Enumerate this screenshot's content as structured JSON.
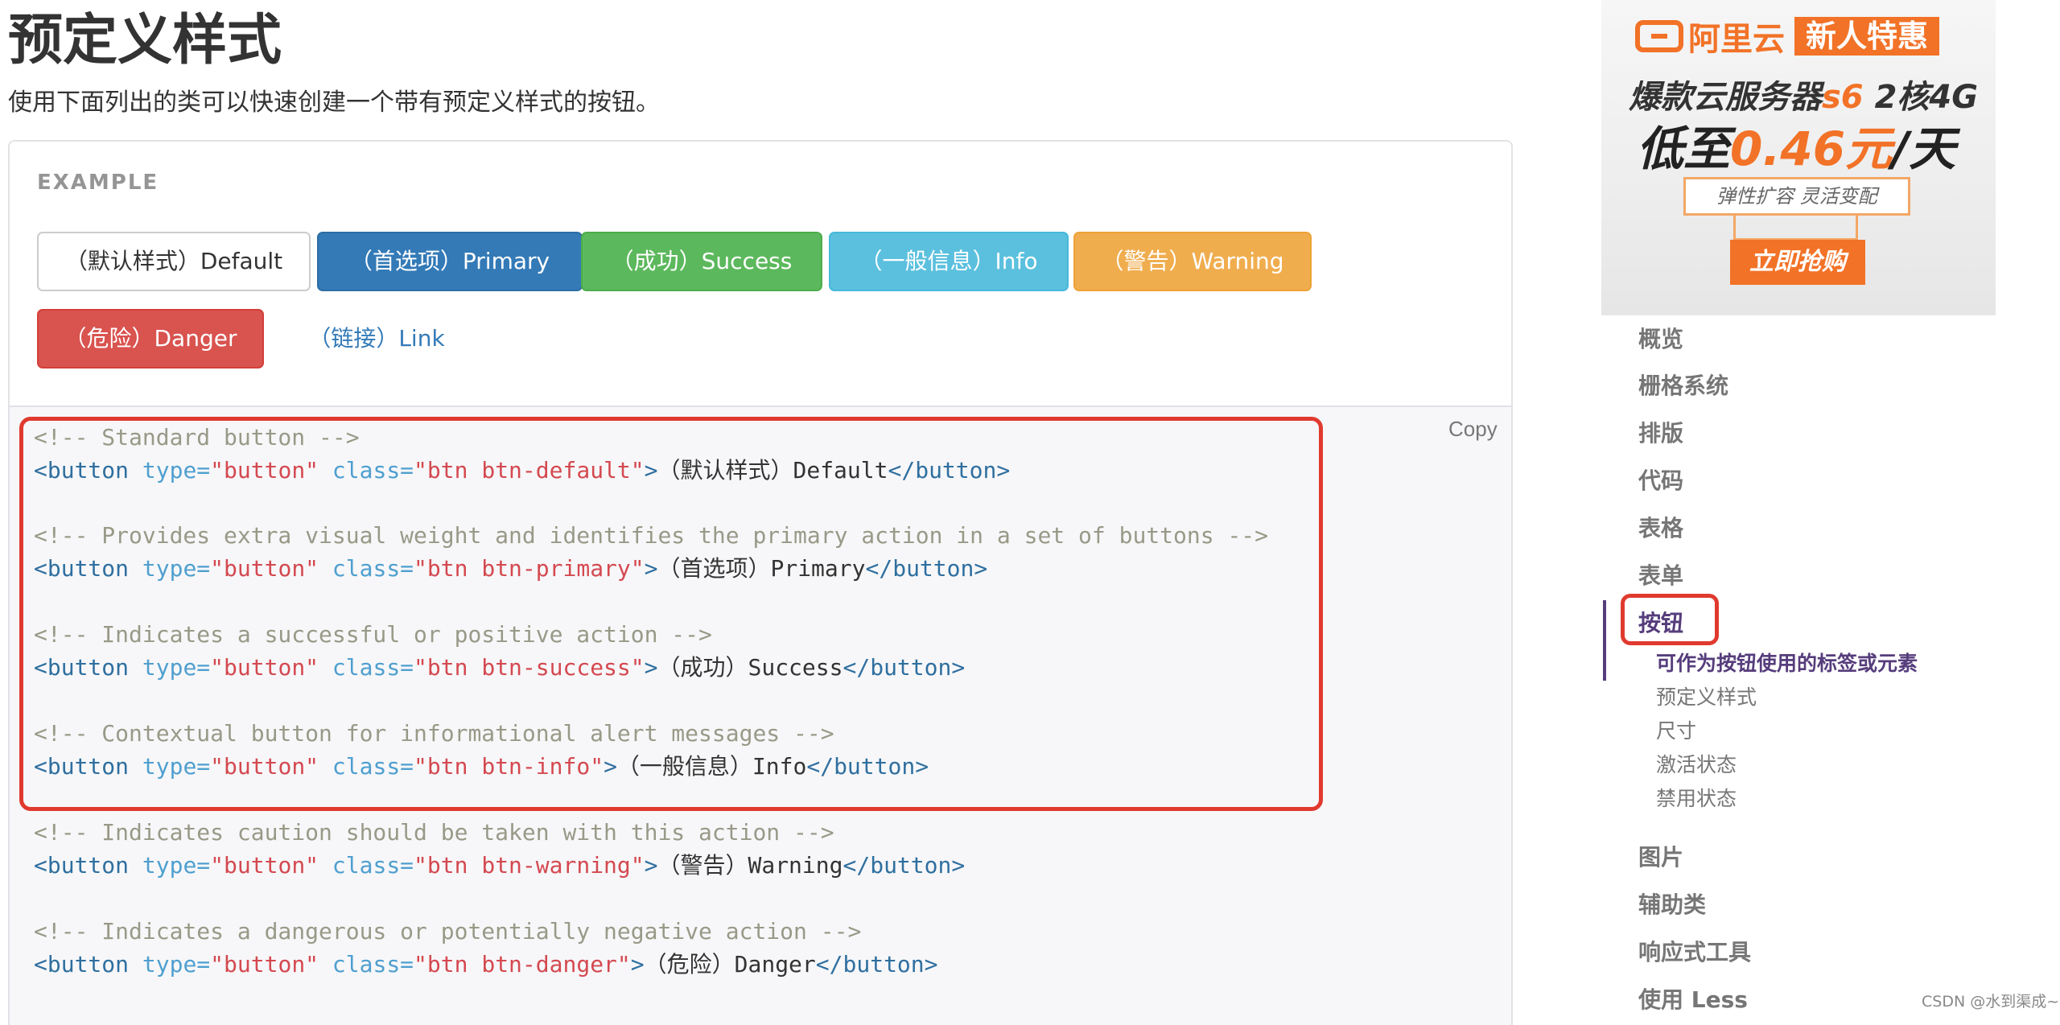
{
  "page": {
    "title": "预定义样式",
    "intro": "使用下面列出的类可以快速创建一个带有预定义样式的按钮。"
  },
  "example": {
    "label": "EXAMPLE",
    "buttons": [
      {
        "label": "（默认样式）Default",
        "style": "default"
      },
      {
        "label": "（首选项）Primary",
        "style": "primary"
      },
      {
        "label": "（成功）Success",
        "style": "success"
      },
      {
        "label": "（一般信息）Info",
        "style": "info"
      },
      {
        "label": "（警告）Warning",
        "style": "warning"
      },
      {
        "label": "（危险）Danger",
        "style": "danger"
      },
      {
        "label": "（链接）Link",
        "style": "link"
      }
    ]
  },
  "code": {
    "copy_label": "Copy",
    "lines": [
      {
        "comment": "<!-- Standard button -->"
      },
      {
        "attr_class": "\"btn btn-default\"",
        "text": "（默认样式）Default"
      },
      {
        "comment": "<!-- Provides extra visual weight and identifies the primary action in a set of buttons -->"
      },
      {
        "attr_class": "\"btn btn-primary\"",
        "text": "（首选项）Primary"
      },
      {
        "comment": "<!-- Indicates a successful or positive action -->"
      },
      {
        "attr_class": "\"btn btn-success\"",
        "text": "（成功）Success"
      },
      {
        "comment": "<!-- Contextual button for informational alert messages -->"
      },
      {
        "attr_class": "\"btn btn-info\"",
        "text": "（一般信息）Info"
      },
      {
        "comment": "<!-- Indicates caution should be taken with this action -->"
      },
      {
        "attr_class": "\"btn btn-warning\"",
        "text": "（警告）Warning"
      },
      {
        "comment": "<!-- Indicates a dangerous or potentially negative action -->"
      },
      {
        "attr_class": "\"btn btn-danger\"",
        "text": "（危险）Danger"
      }
    ],
    "tokens": {
      "open": "<button",
      "type_attr": "type=",
      "type_val": "\"button\"",
      "class_attr": "class=",
      "gt": ">",
      "close": "</button>"
    }
  },
  "ad": {
    "brand": "阿里云",
    "badge": "新人特惠",
    "line1_prefix": "爆款云服务器",
    "line1_highlight": "s6",
    "line1_suffix": "2核4G",
    "line2_prefix": "低至",
    "line2_highlight": "0.46元",
    "line2_suffix": "/天",
    "tag": "弹性扩容 灵活变配",
    "cta": "立即抢购"
  },
  "sidebar": {
    "items": [
      "概览",
      "栅格系统",
      "排版",
      "代码",
      "表格",
      "表单",
      "按钮"
    ],
    "active": "按钮",
    "subitems": [
      "可作为按钮使用的标签或元素",
      "预定义样式",
      "尺寸",
      "激活状态",
      "禁用状态"
    ],
    "items_after": [
      "图片",
      "辅助类",
      "响应式工具",
      "使用 Less"
    ]
  },
  "watermark": "CSDN @水到渠成~",
  "colors": {
    "accent": "#563d7c",
    "annotation": "#e03a2f",
    "ad_orange": "#f27227"
  }
}
